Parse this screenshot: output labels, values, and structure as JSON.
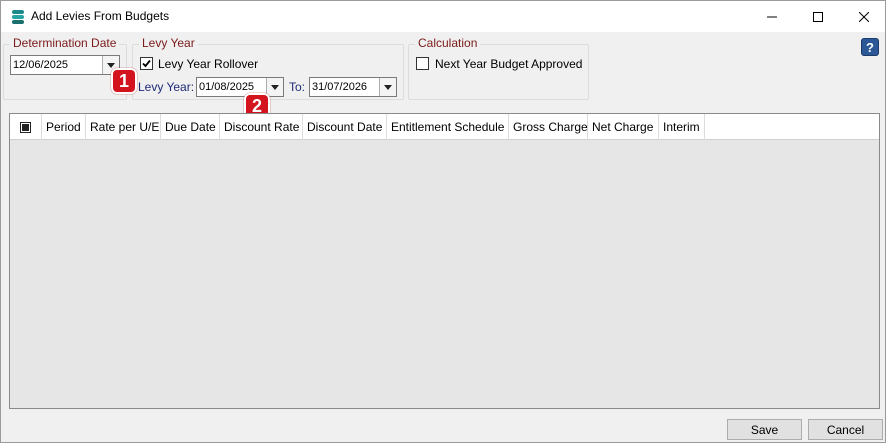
{
  "window": {
    "title": "Add Levies From Budgets",
    "icons": {
      "app": "database-icon",
      "minimize": "minimize-icon",
      "maximize": "maximize-icon",
      "close": "close-icon"
    }
  },
  "determination": {
    "legend": "Determination Date",
    "date": "12/06/2025"
  },
  "levy_year": {
    "legend": "Levy Year",
    "rollover_label": "Levy Year Rollover",
    "rollover_checked": true,
    "levy_year_label": "Levy Year:",
    "from_date": "01/08/2025",
    "to_label": "To:",
    "to_date": "31/07/2026"
  },
  "calculation": {
    "legend": "Calculation",
    "next_year_label": "Next Year Budget Approved",
    "next_year_checked": false
  },
  "badges": [
    "1",
    "2"
  ],
  "help": {
    "label": "?"
  },
  "grid": {
    "columns": [
      "Period",
      "Rate per U/E",
      "Due Date",
      "Discount Rate",
      "Discount Date",
      "Entitlement Schedule",
      "Gross Charge",
      "Net Charge",
      "Interim"
    ],
    "rows": []
  },
  "footer": {
    "save_label": "Save",
    "cancel_label": "Cancel"
  },
  "colors": {
    "legend_text": "#7a1a1a",
    "label_navy": "#1e2a78",
    "badge_red": "#d3131d",
    "help_blue": "#2b5797"
  }
}
